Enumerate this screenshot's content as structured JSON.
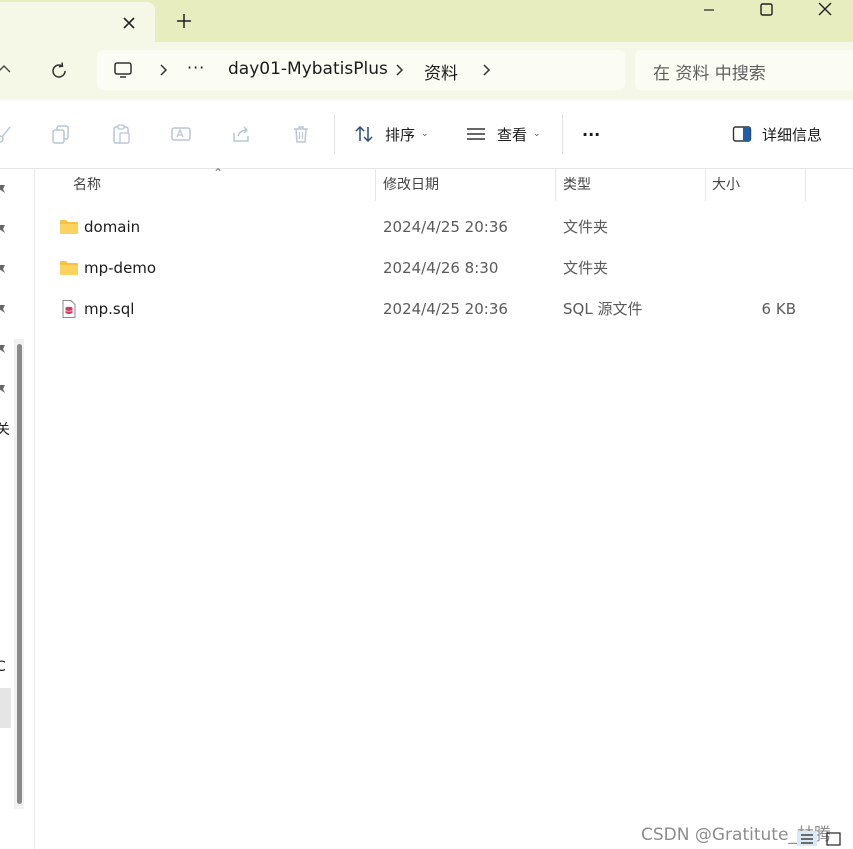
{
  "titlebar": {
    "tab_close_icon": "close-icon",
    "new_tab_icon": "plus-icon",
    "window_controls": [
      "minimize-icon",
      "maximize-icon",
      "close-icon"
    ]
  },
  "navbar": {
    "breadcrumb": {
      "ellipsis": "···",
      "items": [
        "day01-MybatisPlus",
        "资料"
      ]
    },
    "search_placeholder": "在 资料 中搜索"
  },
  "toolbar": {
    "sort_label": "排序",
    "view_label": "查看",
    "more_label": "···",
    "details_label": "详细信息"
  },
  "sidebar": {
    "frag1": "关",
    "frag2": "C"
  },
  "columns": {
    "name": "名称",
    "date": "修改日期",
    "type": "类型",
    "size": "大小"
  },
  "files": [
    {
      "name": "domain",
      "date": "2024/4/25 20:36",
      "type": "文件夹",
      "size": "",
      "icon": "folder-icon"
    },
    {
      "name": "mp-demo",
      "date": "2024/4/26 8:30",
      "type": "文件夹",
      "size": "",
      "icon": "folder-icon"
    },
    {
      "name": "mp.sql",
      "date": "2024/4/25 20:36",
      "type": "SQL 源文件",
      "size": "6 KB",
      "icon": "sql-file-icon"
    }
  ],
  "watermark": "CSDN @Gratitute_林腾",
  "colors": {
    "titlebar": "#e7edbe",
    "navbar": "#f6f8e7",
    "folder": "#f5c342",
    "accent": "#1f5faa"
  }
}
